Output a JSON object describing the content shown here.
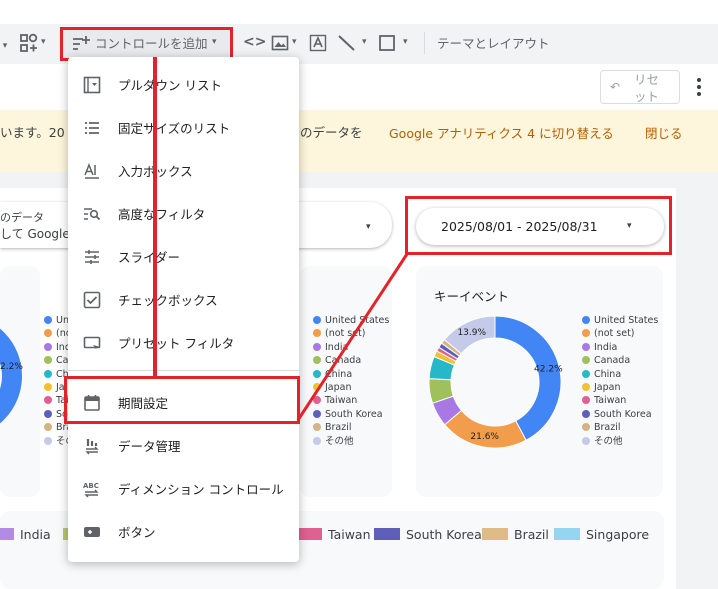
{
  "toolbar": {
    "add_control_label": "コントロールを追加",
    "theme_layout_label": "テーマとレイアウト"
  },
  "header": {
    "reset_label_line1": "リセ",
    "reset_label_line2": "ット"
  },
  "banner": {
    "text_left": "います。20",
    "text_right": "のデータを",
    "switch_link": "Google アナリティクス 4 に切り替える",
    "close_link": "閉じる"
  },
  "data_control": {
    "line1": "のデータ",
    "line2": "して Google"
  },
  "date_range": {
    "value": "2025/08/01 - 2025/08/31"
  },
  "menu": {
    "items": [
      {
        "label": "プルダウン リスト",
        "icon": "dropdown-list-icon"
      },
      {
        "label": "固定サイズのリスト",
        "icon": "fixed-list-icon"
      },
      {
        "label": "入力ボックス",
        "icon": "input-box-icon"
      },
      {
        "label": "高度なフィルタ",
        "icon": "advanced-filter-icon"
      },
      {
        "label": "スライダー",
        "icon": "slider-icon"
      },
      {
        "label": "チェックボックス",
        "icon": "checkbox-icon"
      },
      {
        "label": "プリセット フィルタ",
        "icon": "preset-filter-icon"
      },
      {
        "label": "期間設定",
        "icon": "calendar-icon"
      },
      {
        "label": "データ管理",
        "icon": "data-control-icon"
      },
      {
        "label": "ディメンション コントロール",
        "icon": "dimension-control-icon"
      },
      {
        "label": "ボタン",
        "icon": "button-icon"
      }
    ]
  },
  "left_card": {
    "legend": [
      "Uni",
      "(no",
      "Ind",
      "Cana",
      "Ch",
      "Ja",
      "Tai",
      "So",
      "Bra",
      "その"
    ],
    "pie_label": "2.2%"
  },
  "middle_card": {
    "legend": [
      "United States",
      "(not set)",
      "India",
      "Canada",
      "China",
      "Japan",
      "Taiwan",
      "South Korea",
      "Brazil",
      "その他"
    ]
  },
  "chart_data": {
    "type": "pie",
    "title": "キーイベント",
    "categories": [
      "United States",
      "(not set)",
      "India",
      "Canada",
      "China",
      "Japan",
      "Taiwan",
      "South Korea",
      "Brazil",
      "その他"
    ],
    "values": [
      42.2,
      21.6,
      6.0,
      6.0,
      5.5,
      1.5,
      1.0,
      1.2,
      1.1,
      13.9
    ],
    "data_labels": [
      "42.2%",
      "21.6%",
      "13.9%"
    ],
    "colors": [
      "#4285f4",
      "#f29d4b",
      "#a879e4",
      "#9fc05a",
      "#26b7c9",
      "#f2c12e",
      "#e06092",
      "#5f5fba",
      "#d4b483",
      "#c5cae9"
    ],
    "legend_position": "right"
  },
  "bottom_legend": {
    "items": [
      {
        "label": "India",
        "color": "#b38be6"
      },
      {
        "label": "Taiwan",
        "color": "#e06092"
      },
      {
        "label": "South Korea",
        "color": "#5f5fba"
      },
      {
        "label": "Brazil",
        "color": "#dfbb86"
      },
      {
        "label": "Singapore",
        "color": "#94d5f0"
      }
    ]
  }
}
